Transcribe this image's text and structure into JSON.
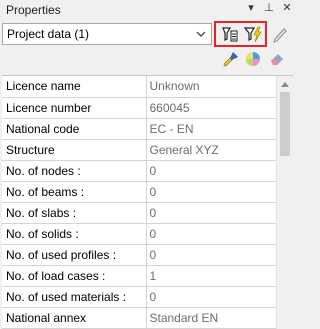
{
  "panel": {
    "title": "Properties",
    "controls": {
      "dropdown_glyph": "▾",
      "pin_glyph": "⊥",
      "close_glyph": "✕"
    }
  },
  "selector": {
    "value": "Project data (1)"
  },
  "toolbar": {
    "icons": [
      "filter-list-icon",
      "filter-lightning-icon",
      "pencil-icon",
      "brush-icon",
      "color-palette-icon",
      "eraser-icon"
    ]
  },
  "properties": [
    {
      "name": "Licence name",
      "value": "Unknown"
    },
    {
      "name": "Licence number",
      "value": "660045"
    },
    {
      "name": "National code",
      "value": "EC - EN"
    },
    {
      "name": "Structure",
      "value": "General XYZ"
    },
    {
      "name": "No. of nodes :",
      "value": "0"
    },
    {
      "name": "No. of beams :",
      "value": "0"
    },
    {
      "name": "No. of slabs :",
      "value": "0"
    },
    {
      "name": "No. of solids :",
      "value": "0"
    },
    {
      "name": "No. of used profiles :",
      "value": "0"
    },
    {
      "name": "No. of load cases :",
      "value": "1"
    },
    {
      "name": "No. of used materials :",
      "value": "0"
    },
    {
      "name": "National annex",
      "value": "Standard EN"
    }
  ],
  "colors": {
    "highlight": "#e8242b",
    "value_text": "#6d6d6d"
  }
}
